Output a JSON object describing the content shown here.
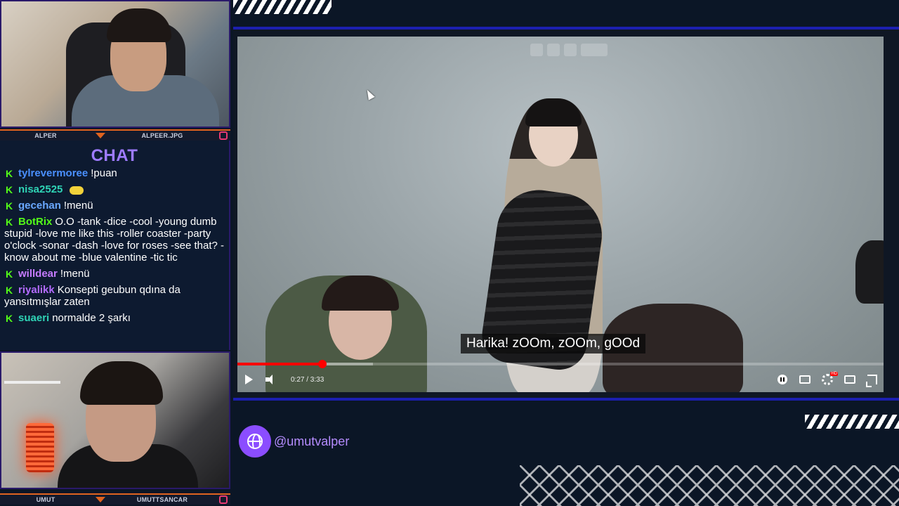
{
  "webcams": {
    "top": {
      "left_name": "ALPER",
      "right_name": "ALPEER.JPG"
    },
    "bottom": {
      "left_name": "UMUT",
      "right_name": "UMUTTSANCAR"
    }
  },
  "chat": {
    "title": "CHAT",
    "badge_icon": "kick-k-icon",
    "badge_color": "#53fc18",
    "messages": [
      {
        "user": "tylrevermoree",
        "color": "#4a90ff",
        "text": "!puan"
      },
      {
        "user": "nisa2525",
        "color": "#2fd3b5",
        "text": ""
      },
      {
        "user": "gecehan",
        "color": "#6aa8ff",
        "text": "!menü"
      },
      {
        "user": "BotRix",
        "color": "#53fc18",
        "text": "O.O -tank -dice -cool -young dumb stupid -love me like this -roller coaster -party o'clock -sonar -dash -love for roses -see that? -know about me -blue valentine -tic tic"
      },
      {
        "user": "willdear",
        "color": "#c57bff",
        "text": "!menü"
      },
      {
        "user": "riyalikk",
        "color": "#b36bff",
        "text": "Konsepti geubun qdına da yansıtmışlar zaten"
      },
      {
        "user": "suaeri",
        "color": "#2fd3b5",
        "text": "normalde 2 şarkı"
      }
    ]
  },
  "player": {
    "caption": "Harika! zOOm, zOOm, gOOd",
    "current_time": "0:27",
    "duration": "3:33",
    "time_display": "0:27 / 3:33",
    "played_fraction": 0.131,
    "loaded_fraction": 0.21,
    "progress_color": "#ff0000",
    "controls_left": [
      "play-icon",
      "volume-icon"
    ],
    "controls_right": [
      "autoplay-toggle-icon",
      "subtitles-icon",
      "settings-icon",
      "theater-mode-icon",
      "fullscreen-icon"
    ]
  },
  "social": {
    "icon": "globe-icon",
    "handle": "@umutvalper",
    "accent": "#8b4dff"
  }
}
